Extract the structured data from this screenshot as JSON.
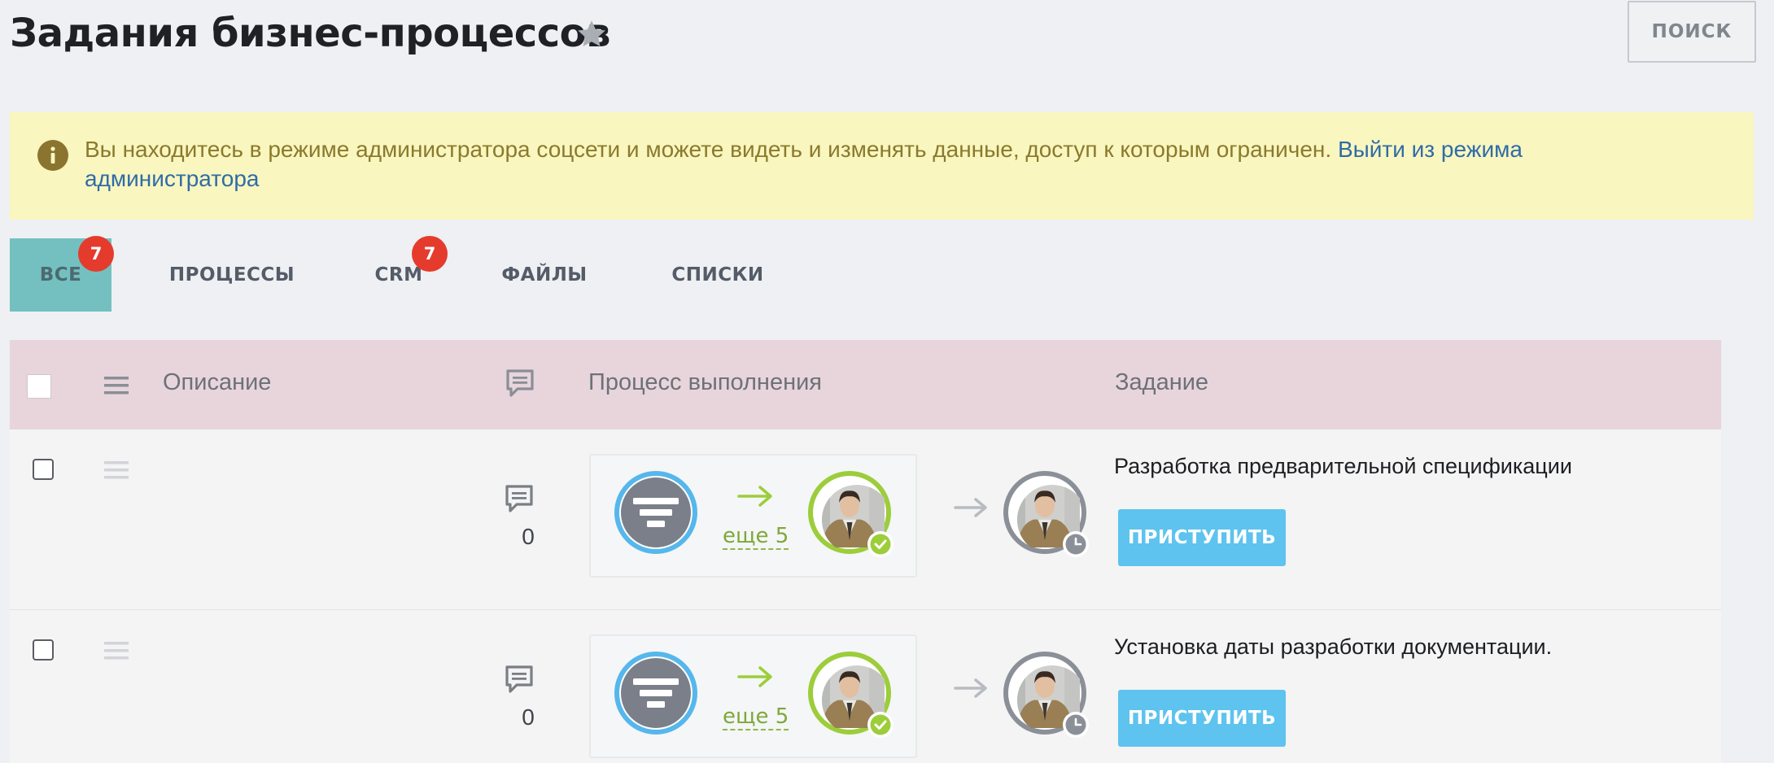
{
  "header": {
    "title": "Задания бизнес-процессов",
    "search_label": "ПОИСК"
  },
  "alert": {
    "text": "Вы находитесь в режиме администратора соцсети и можете видеть и изменять данные, доступ к которым ограничен. ",
    "link_text": "Выйти из режима администратора"
  },
  "tabs": [
    {
      "label": "ВСЕ",
      "badge": "7",
      "active": true
    },
    {
      "label": "ПРОЦЕССЫ",
      "badge": null,
      "active": false
    },
    {
      "label": "CRM",
      "badge": "7",
      "active": false
    },
    {
      "label": "ФАЙЛЫ",
      "badge": null,
      "active": false
    },
    {
      "label": "СПИСКИ",
      "badge": null,
      "active": false
    }
  ],
  "grid": {
    "columns": {
      "description": "Описание",
      "process": "Процесс выполнения",
      "task": "Задание"
    },
    "rows": [
      {
        "comments": "0",
        "more_label": "еще 5",
        "task_title": "Разработка предварительной спецификации",
        "action_label": "ПРИСТУПИТЬ"
      },
      {
        "comments": "0",
        "more_label": "еще 5",
        "task_title": "Установка даты разработки документации.",
        "action_label": "ПРИСТУПИТЬ"
      }
    ]
  },
  "colors": {
    "tab_active": "#74c0c0",
    "badge": "#e53b2d",
    "header_row": "#e8d5dc",
    "alert_bg": "#f9f6bf",
    "button": "#5ec3ee",
    "ring_blue": "#55b7ec",
    "ring_green": "#9ccd3a",
    "ring_gray": "#8b9098"
  }
}
